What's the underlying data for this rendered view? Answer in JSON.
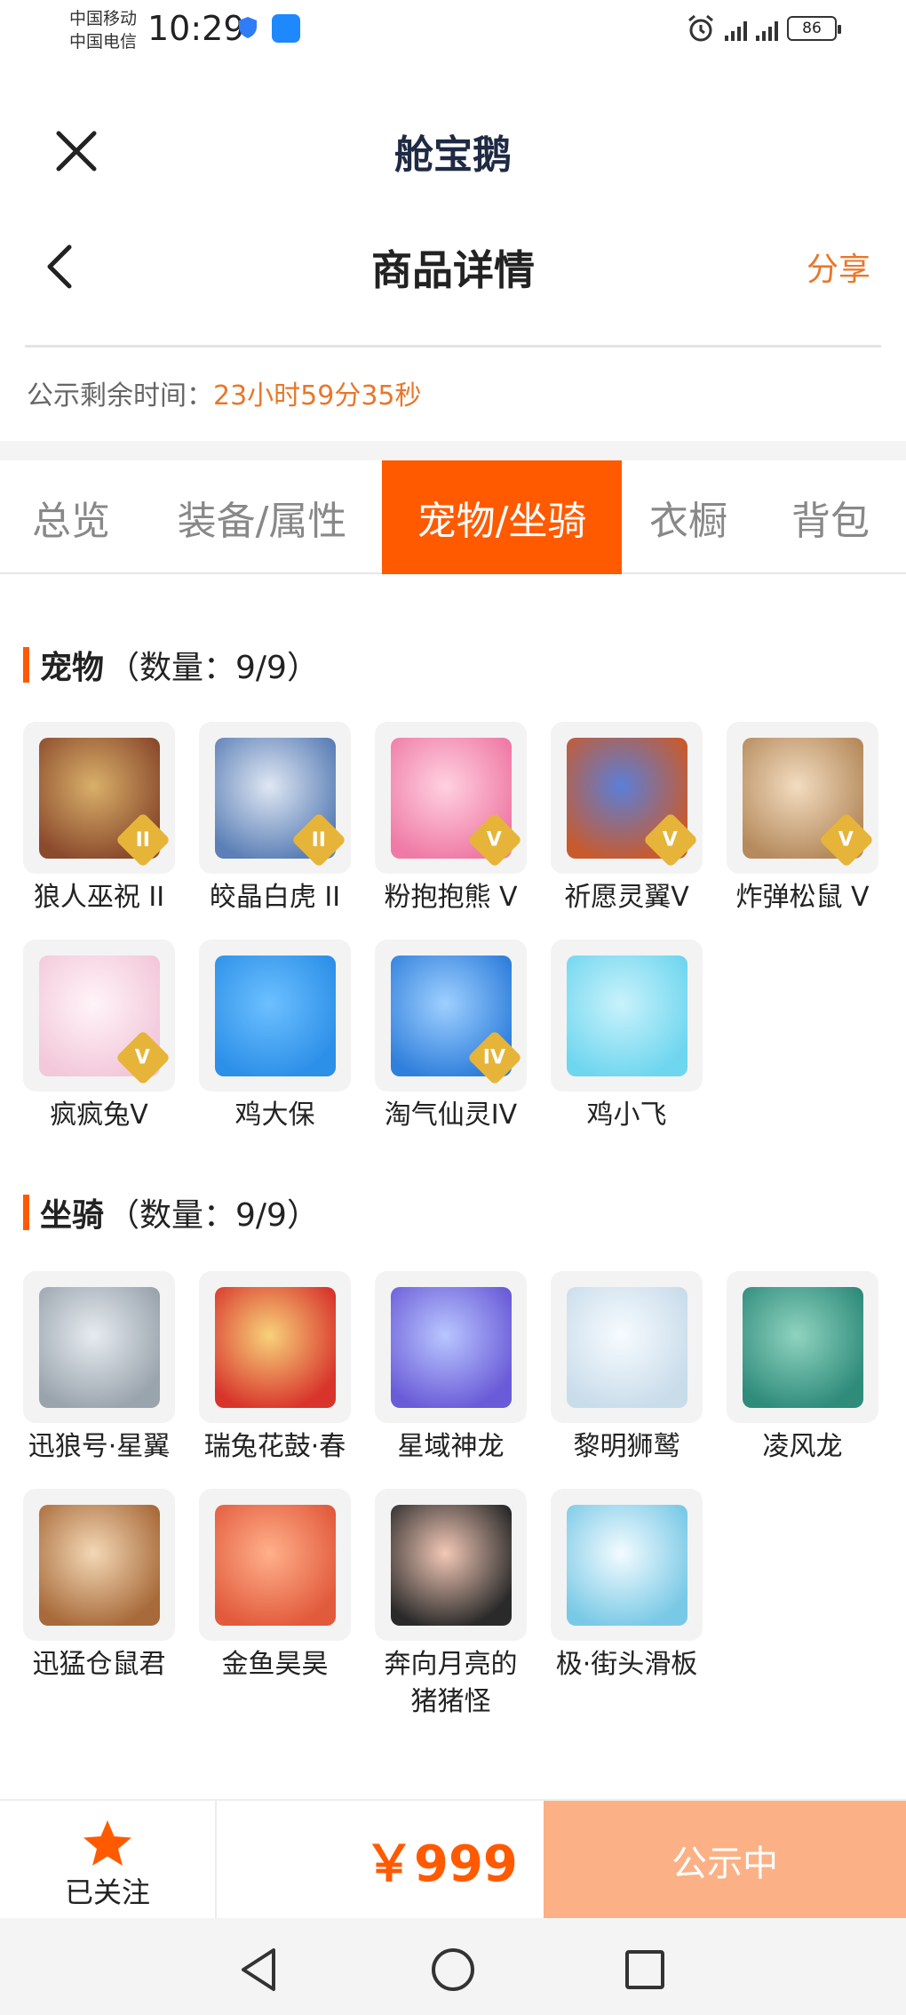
{
  "status_bar": {
    "carrier_1": "中国移动",
    "carrier_2": "中国电信",
    "time": "10:29",
    "signal_1": "4G",
    "signal_2": "4G",
    "battery": "86"
  },
  "app": {
    "title": "舱宝鹅"
  },
  "page": {
    "title": "商品详情",
    "share": "分享"
  },
  "countdown": {
    "label": "公示剩余时间：",
    "value": "23小时59分35秒"
  },
  "tabs": [
    "总览",
    "装备/属性",
    "宠物/坐骑",
    "衣橱",
    "背包"
  ],
  "active_tab_index": 2,
  "pets": {
    "title": "宠物",
    "count": "（数量：9/9）",
    "items": [
      {
        "label": "狼人巫祝 II",
        "tier": "II",
        "colors": [
          "#8a4a2c",
          "#d9b06a"
        ]
      },
      {
        "label": "皎晶白虎 II",
        "tier": "II",
        "colors": [
          "#5b7fb6",
          "#dfe7f3"
        ]
      },
      {
        "label": "粉抱抱熊 V",
        "tier": "V",
        "colors": [
          "#ef7aa5",
          "#ffd1e0"
        ]
      },
      {
        "label": "祈愿灵翼V",
        "tier": "V",
        "colors": [
          "#c95a2c",
          "#5a7fd8"
        ]
      },
      {
        "label": "炸弹松鼠 V",
        "tier": "V",
        "colors": [
          "#b58a5c",
          "#f2dcc0"
        ]
      },
      {
        "label": "疯疯兔V",
        "tier": "V",
        "colors": [
          "#f3c8da",
          "#fff4f8"
        ]
      },
      {
        "label": "鸡大保",
        "tier": "",
        "colors": [
          "#2c8fe8",
          "#6cc0ff"
        ]
      },
      {
        "label": "淘气仙灵IV",
        "tier": "IV",
        "colors": [
          "#2f7fdc",
          "#9fd0ff"
        ]
      },
      {
        "label": "鸡小飞",
        "tier": "",
        "colors": [
          "#6fd6ef",
          "#c9f2fb"
        ]
      }
    ]
  },
  "mounts": {
    "title": "坐骑",
    "count": "（数量：9/9）",
    "items": [
      {
        "label": "迅狼号·星翼",
        "colors": [
          "#9aa4ad",
          "#e6ebf0"
        ]
      },
      {
        "label": "瑞兔花鼓·春",
        "colors": [
          "#d8342b",
          "#f7d27a"
        ]
      },
      {
        "label": "星域神龙",
        "colors": [
          "#6a5bd8",
          "#b9c6ff"
        ]
      },
      {
        "label": "黎明狮鹫",
        "colors": [
          "#c9dcea",
          "#f6fbff"
        ]
      },
      {
        "label": "凌风龙",
        "colors": [
          "#2f8b7a",
          "#8fd3c0"
        ]
      },
      {
        "label": "迅猛仓鼠君",
        "colors": [
          "#a86a3a",
          "#f3d8b5"
        ]
      },
      {
        "label": "金鱼昊昊",
        "colors": [
          "#e25a3c",
          "#ffb08a"
        ]
      },
      {
        "label": "奔向月亮的猪猪怪",
        "colors": [
          "#2a2a2a",
          "#f3c8b6"
        ]
      },
      {
        "label": "极·街头滑板",
        "colors": [
          "#79c9e6",
          "#f3fbff"
        ]
      }
    ]
  },
  "bottom": {
    "follow_label": "已关注",
    "price": "￥999",
    "action_label": "公示中"
  },
  "colors": {
    "accent": "#ff5a00",
    "orange_text": "#e8772a",
    "action_bg": "#fbb185"
  }
}
